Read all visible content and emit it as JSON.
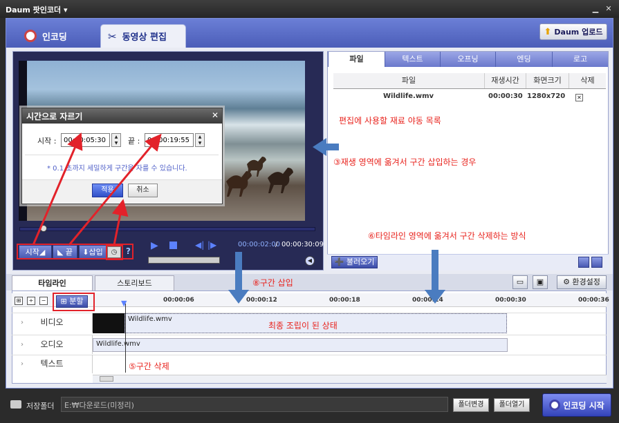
{
  "window": {
    "title": "Daum 팟인코더 ▾",
    "min": "▁",
    "close": "✕"
  },
  "main_tabs": {
    "encoding": "인코딩",
    "edit": "동영상 편집"
  },
  "upload_button": "Daum 업로드",
  "player": {
    "start_btn": "시작◢",
    "end_btn": "◣ 끝",
    "insert_btn": "⬇삽입",
    "help": "?",
    "time_current": "00:00:02:00",
    "time_separator": "/",
    "time_total": "00:00:30:09"
  },
  "dialog": {
    "title": "시간으로 자르기",
    "close": "✕",
    "start_label": "시작 :",
    "start_value": "00:00:05:30",
    "end_label": "끝 :",
    "end_value": "00:00:19:55",
    "note": "* 0.1 초까지 세밀하게 구간을 자를 수 있습니다.",
    "ok": "적용",
    "cancel": "취소"
  },
  "sub_tabs": [
    "파일",
    "텍스트",
    "오프닝",
    "엔딩",
    "로고"
  ],
  "file_table": {
    "columns": [
      "파일",
      "재생시간",
      "화면크기",
      "삭제"
    ],
    "rows": [
      {
        "name": "Wildlife.wmv",
        "duration": "00:00:30",
        "size": "1280x720",
        "delete": "✕"
      }
    ]
  },
  "annotations": {
    "file_list": "편집에 사용할 재료 야동 목록",
    "drag_to_player": "③재생 영역에 옮겨서 구간 삽입하는 경우",
    "drag_to_timeline": "⑥타임라인 영역에 옮겨서 구간 삭제하는 방식",
    "insert_section": "⑧구간 삽입",
    "final_assembly": "최종 조립이 된 상태",
    "delete_section": "⑤구간 삭제"
  },
  "load_button": "➕ 불러오기",
  "timeline_tabs": {
    "timeline": "타임라인",
    "storyboard": "스토리보드"
  },
  "settings_button": "⚙ 환경설정",
  "split_button": "⊞ 분할",
  "ruler_ticks": [
    "00:00:06",
    "00:00:12",
    "00:00:18",
    "00:00:24",
    "00:00:30",
    "00:00:36"
  ],
  "tracks": {
    "video": "비디오",
    "audio": "오디오",
    "text": "텍스트"
  },
  "clips": {
    "video": "Wildlife.wmv",
    "audio": "Wildlife.wmv"
  },
  "footer": {
    "save_label": "저장폴더",
    "save_path": "E:₩다운로드(미정리)",
    "change_folder": "폴더변경",
    "open_folder": "폴더열기",
    "start_encode": "인코딩 시작"
  },
  "colors": {
    "accent": "#5a6bb8",
    "annotation_red": "#e8221c",
    "arrow_blue": "#4a7cc0"
  }
}
